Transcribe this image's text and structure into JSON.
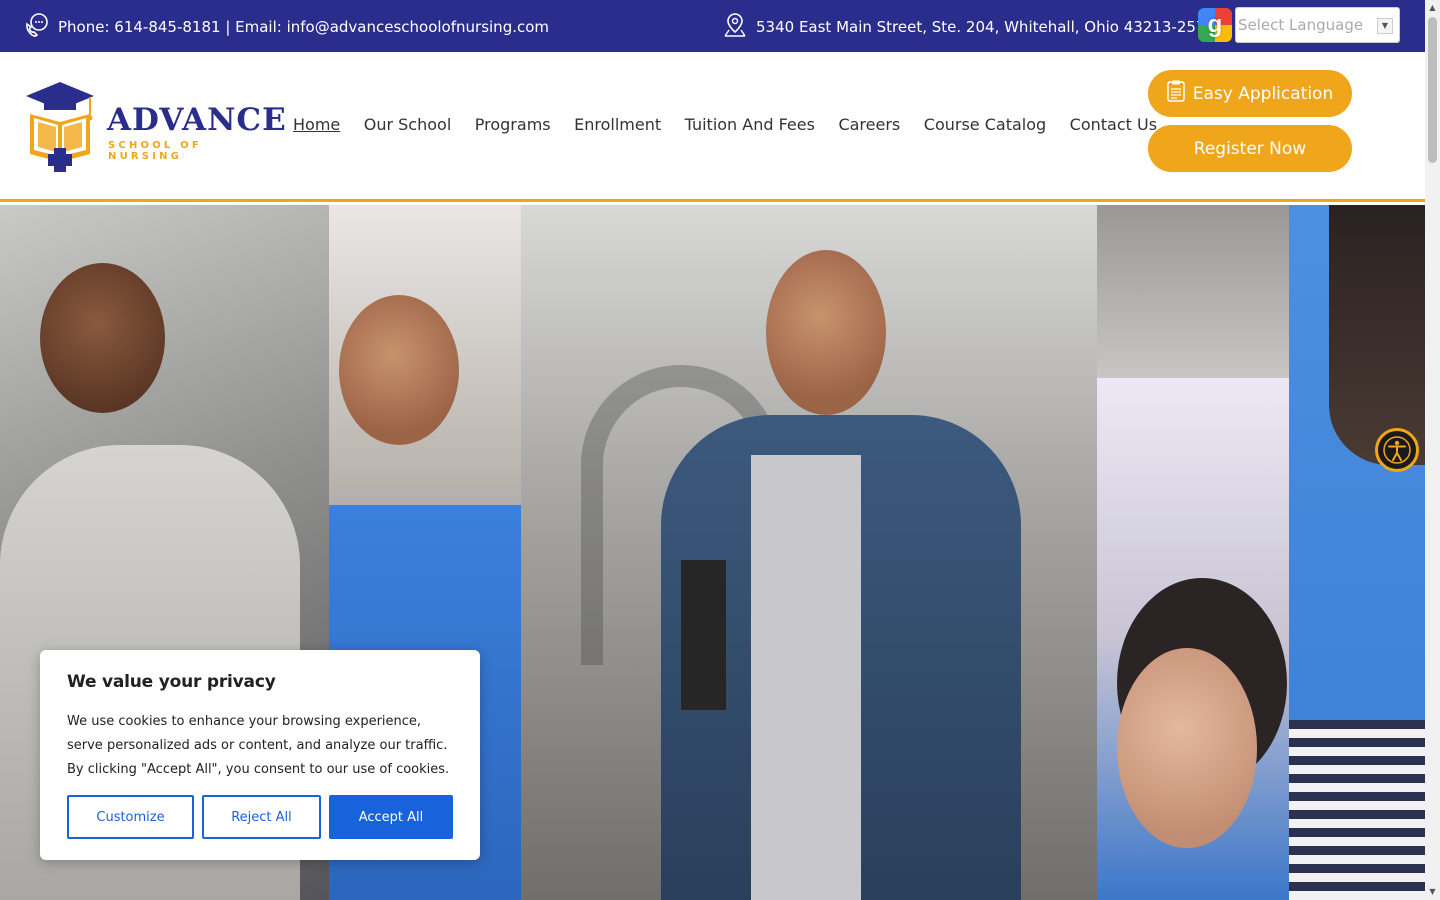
{
  "topbar": {
    "contact_text": "Phone: 614-845-8181 | Email: info@advanceschoolofnursing.com",
    "phone_icon": "phone-chat-icon",
    "address_text": "5340 East Main Street, Ste. 204, Whitehall, Ohio 43213-2574",
    "address_icon": "map-pin-icon",
    "translate_icon": "google-icon",
    "language_placeholder": "Select Language"
  },
  "logo": {
    "brand": "ADVANCE",
    "subtitle": "SCHOOL OF NURSING"
  },
  "nav": {
    "items": [
      {
        "label": "Home",
        "active": true
      },
      {
        "label": "Our School"
      },
      {
        "label": "Programs"
      },
      {
        "label": "Enrollment"
      },
      {
        "label": "Tuition And Fees"
      },
      {
        "label": "Careers"
      },
      {
        "label": "Course Catalog"
      },
      {
        "label": "Contact Us"
      }
    ]
  },
  "buttons": {
    "easy_application": "Easy Application",
    "register_now": "Register Now"
  },
  "cookie": {
    "title": "We value your privacy",
    "body": "We use cookies to enhance your browsing experience, serve personalized ads or content, and analyze our traffic. By clicking \"Accept All\", you consent to our use of cookies.",
    "customize": "Customize",
    "reject": "Reject All",
    "accept": "Accept All"
  },
  "colors": {
    "brand_blue": "#2b2d8c",
    "brand_orange": "#f0a61b",
    "cookie_blue": "#1863dc"
  }
}
